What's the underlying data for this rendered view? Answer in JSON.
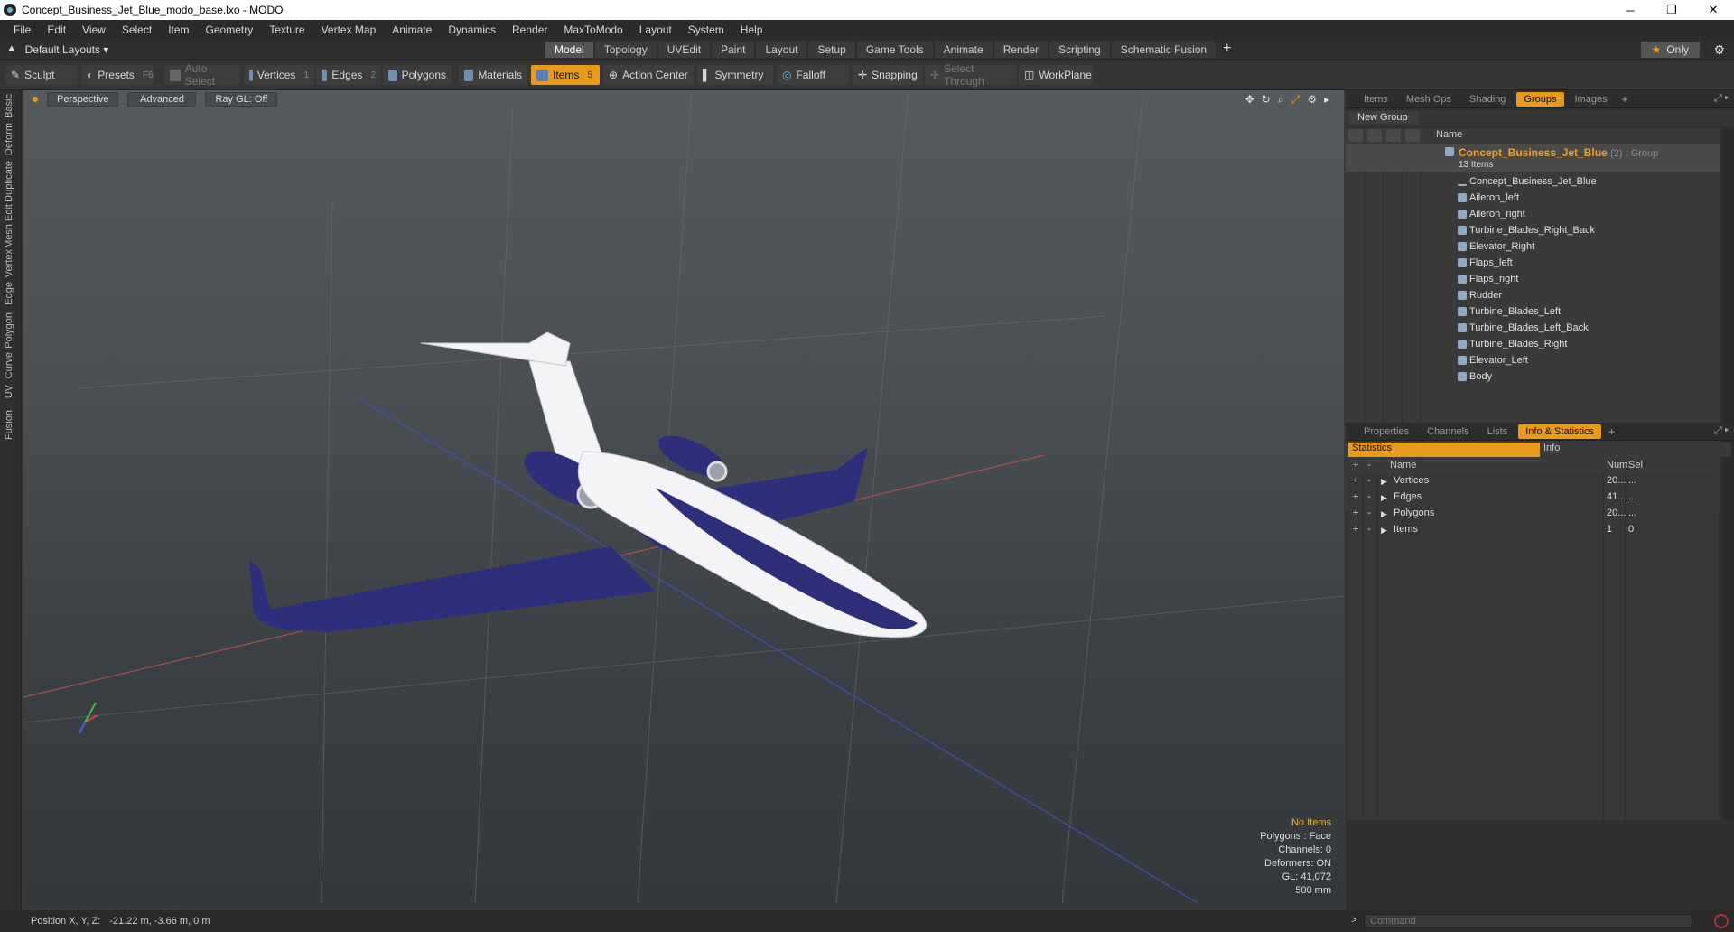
{
  "window": {
    "title": "Concept_Business_Jet_Blue_modo_base.lxo - MODO",
    "minimize": "─",
    "maximize": "❐",
    "close": "✕"
  },
  "menu": [
    "File",
    "Edit",
    "View",
    "Select",
    "Item",
    "Geometry",
    "Texture",
    "Vertex Map",
    "Animate",
    "Dynamics",
    "Render",
    "MaxToModo",
    "Layout",
    "System",
    "Help"
  ],
  "layout_selector": "Default Layouts ▾",
  "mode_tabs": [
    {
      "label": "Model",
      "active": true
    },
    {
      "label": "Topology",
      "active": false
    },
    {
      "label": "UVEdit",
      "active": false
    },
    {
      "label": "Paint",
      "active": false
    },
    {
      "label": "Layout",
      "active": false
    },
    {
      "label": "Setup",
      "active": false
    },
    {
      "label": "Game Tools",
      "active": false
    },
    {
      "label": "Animate",
      "active": false
    },
    {
      "label": "Render",
      "active": false
    },
    {
      "label": "Scripting",
      "active": false
    },
    {
      "label": "Schematic Fusion",
      "active": false
    }
  ],
  "only_label": "Only",
  "toolbar": {
    "sculpt": "Sculpt",
    "presets": "Presets",
    "presets_key": "F6",
    "auto_select": "Auto Select",
    "vertices": "Vertices",
    "vertices_key": "1",
    "edges": "Edges",
    "edges_key": "2",
    "polygons": "Polygons",
    "materials": "Materials",
    "items": "Items",
    "items_key": "5",
    "action_center": "Action Center",
    "symmetry": "Symmetry",
    "falloff": "Falloff",
    "snapping": "Snapping",
    "select_through": "Select Through",
    "workplane": "WorkPlane"
  },
  "left_tabs": [
    "Basic",
    "Deform",
    "Duplicate",
    "Mesh Edit",
    "Vertex",
    "Edge",
    "Polygon",
    "Curve",
    "UV",
    "Fusion"
  ],
  "viewport": {
    "view_mode": "Perspective",
    "shading": "Advanced",
    "raygl": "Ray GL: Off",
    "stats": {
      "no_items": "No Items",
      "polygons": "Polygons : Face",
      "channels": "Channels: 0",
      "deformers": "Deformers: ON",
      "gl": "GL: 41,072",
      "scale": "500 mm"
    },
    "colors": {
      "fuselage": "#f4f4f6",
      "wing": "#2e2f7a",
      "accent": "#e89a1a"
    }
  },
  "status": {
    "position_label": "Position X, Y, Z:",
    "position_value": "-21.22 m, -3.66 m, 0 m"
  },
  "top_panel": {
    "tabs": [
      {
        "label": "Items",
        "active": false
      },
      {
        "label": "Mesh Ops",
        "active": false
      },
      {
        "label": "Shading",
        "active": false
      },
      {
        "label": "Groups",
        "active": true
      },
      {
        "label": "Images",
        "active": false
      }
    ],
    "new_group": "New Group",
    "name_header": "Name",
    "group": {
      "name": "Concept_Business_Jet_Blue",
      "type": "(2) : Group",
      "count": "13 Items"
    },
    "items": [
      "Concept_Business_Jet_Blue",
      "Aileron_left",
      "Aileron_right",
      "Turbine_Blades_Right_Back",
      "Elevator_Right",
      "Flaps_left",
      "Flaps_right",
      "Rudder",
      "Turbine_Blades_Left",
      "Turbine_Blades_Left_Back",
      "Turbine_Blades_Right",
      "Elevator_Left",
      "Body"
    ]
  },
  "bottom_panel": {
    "tabs": [
      {
        "label": "Properties",
        "active": false
      },
      {
        "label": "Channels",
        "active": false
      },
      {
        "label": "Lists",
        "active": false
      },
      {
        "label": "Info & Statistics",
        "active": true
      }
    ],
    "sub_tabs": [
      "Statistics",
      "Info"
    ],
    "headers": {
      "name": "Name",
      "num": "Num",
      "sel": "Sel"
    },
    "rows": [
      {
        "name": "Vertices",
        "num": "20...",
        "sel": "..."
      },
      {
        "name": "Edges",
        "num": "41...",
        "sel": "..."
      },
      {
        "name": "Polygons",
        "num": "20...",
        "sel": "..."
      },
      {
        "name": "Items",
        "num": "1",
        "sel": "0"
      }
    ]
  },
  "command": {
    "placeholder": "Command"
  }
}
